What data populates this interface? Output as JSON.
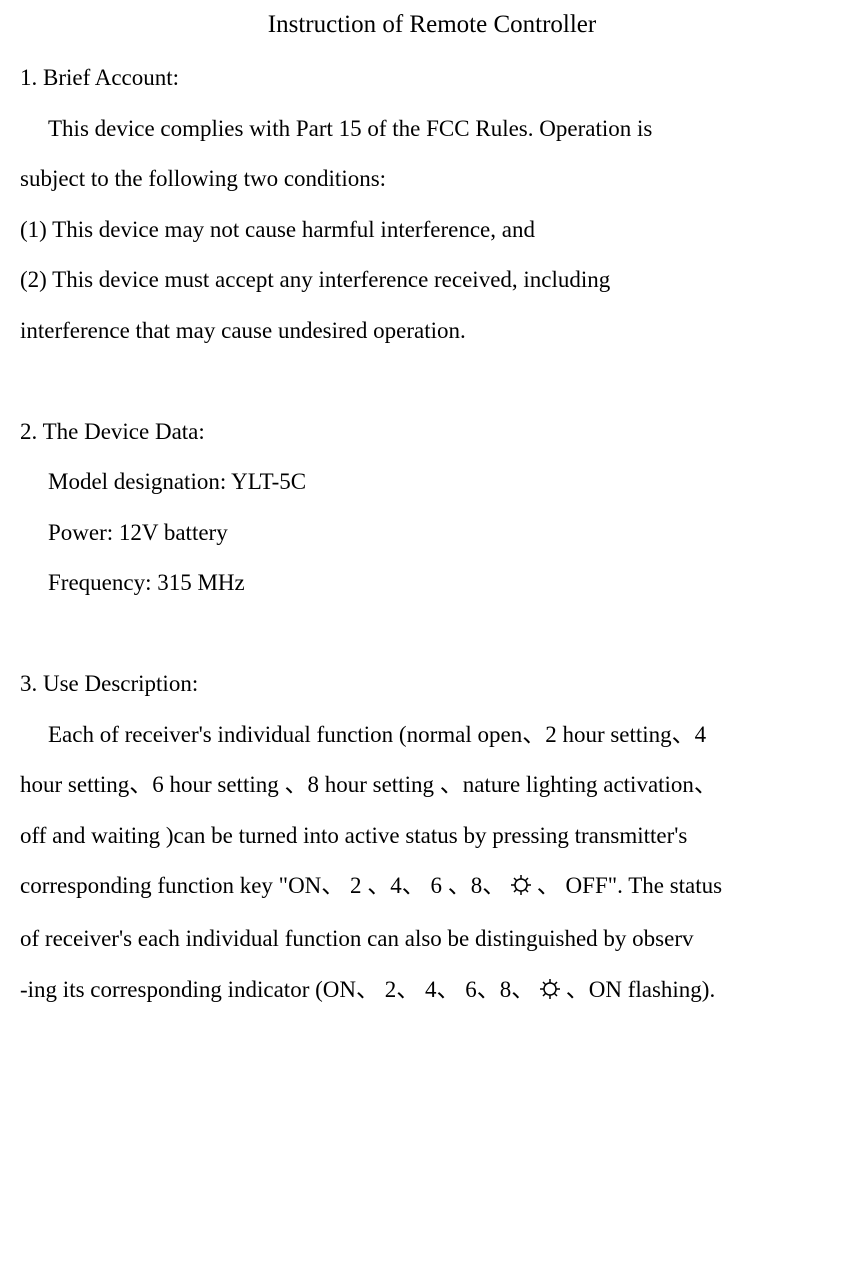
{
  "title": "Instruction of Remote Controller",
  "section1": {
    "heading": "1. Brief Account:",
    "p1a": "This device complies with Part 15 of the FCC Rules.  Operation is",
    "p1b": "subject to the following two conditions:",
    "c1": "(1) This device may not cause harmful interference, and",
    "c2a": "(2) This device must accept any interference received, including",
    "c2b": "interference that may cause undesired operation."
  },
  "section2": {
    "heading": "2. The Device Data:",
    "model": "Model designation: YLT-5C",
    "power": "Power: 12V battery",
    "frequency": "Frequency: 315 MHz"
  },
  "section3": {
    "heading": "3. Use Description:",
    "l1": "Each of receiver's individual function (normal open、2 hour setting、4",
    "l2": "hour setting、6 hour setting 、8 hour setting 、nature lighting activation、",
    "l3": "off and waiting )can be turned into active status by pressing transmitter's",
    "l4a": "corresponding function key \"ON、 2 、4、 6 、8、 ",
    "l4b": " 、 OFF\". The status",
    "l5": "of receiver's each individual function can also be distinguished by observ",
    "l6a": "-ing its corresponding indicator (ON、 2、 4、 6、8、 ",
    "l6b": "  、ON flashing)."
  }
}
